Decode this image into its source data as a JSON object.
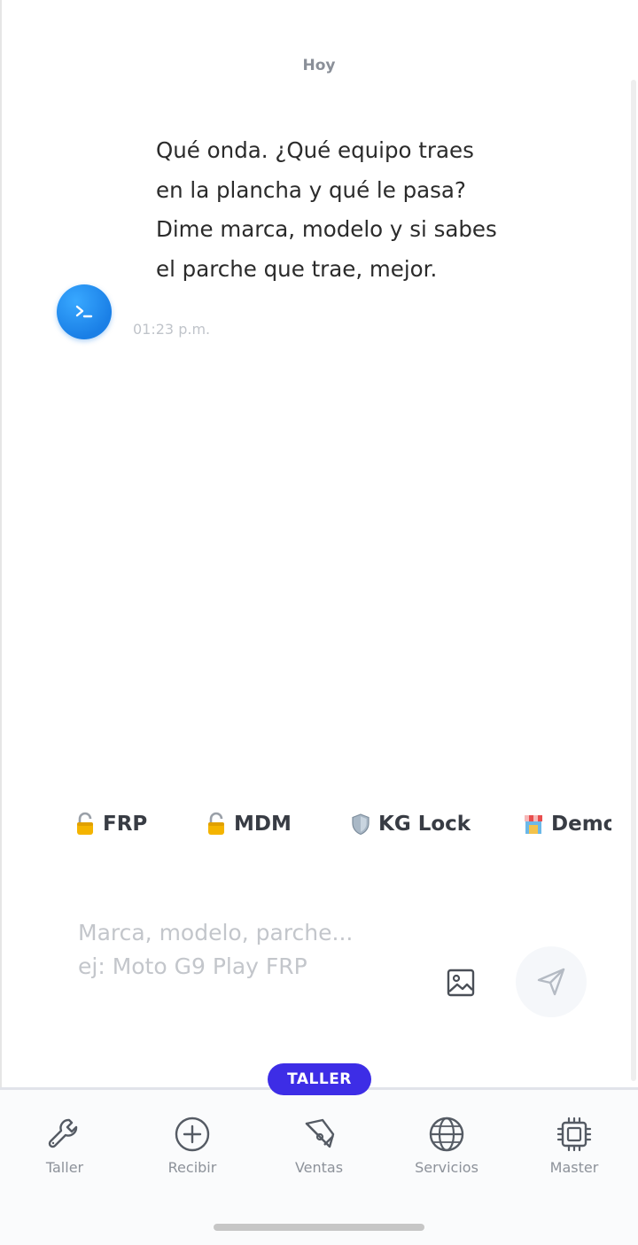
{
  "chat": {
    "date_separator": "Hoy",
    "message": {
      "lines": [
        "Qué onda. ¿Qué equipo traes",
        "en la plancha y qué le pasa?",
        "Dime marca, modelo y si sabes",
        "el parche que trae, mejor."
      ],
      "time": "01:23 p.m.",
      "avatar_icon": "terminal-icon"
    }
  },
  "quick_chips": [
    {
      "label": "FRP",
      "icon": "lock-icon"
    },
    {
      "label": "MDM",
      "icon": "lock-icon"
    },
    {
      "label": "KG Lock",
      "icon": "shield-icon"
    },
    {
      "label": "Demo",
      "icon": "store-icon"
    }
  ],
  "composer": {
    "placeholder_line1": "Marca, modelo, parche...",
    "placeholder_line2": "ej: Moto G9 Play FRP",
    "image_icon": "image-icon",
    "send_icon": "send-icon"
  },
  "nav": {
    "active_badge": "TALLER",
    "items": [
      {
        "label": "Taller",
        "icon": "wrench-icon"
      },
      {
        "label": "Recibir",
        "icon": "plus-circle-icon"
      },
      {
        "label": "Ventas",
        "icon": "pen-tool-icon"
      },
      {
        "label": "Servicios",
        "icon": "globe-icon"
      },
      {
        "label": "Master",
        "icon": "chip-icon"
      }
    ]
  },
  "colors": {
    "accent": "#3d2de6",
    "avatar": "#1a7fe6",
    "text": "#2b2b2b",
    "muted": "#8d929a"
  }
}
